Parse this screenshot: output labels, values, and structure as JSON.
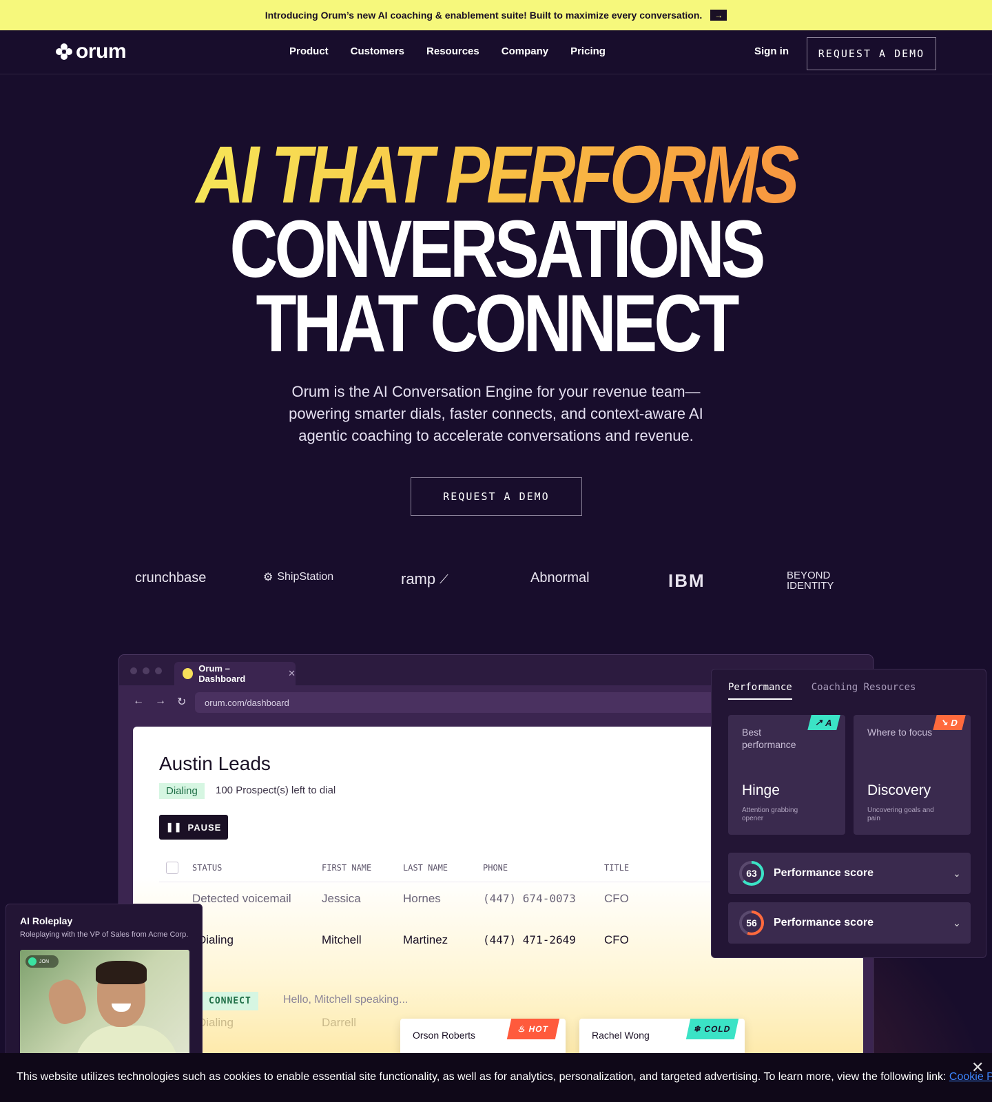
{
  "announcement": {
    "text": "Introducing Orum’s new AI coaching & enablement suite! Built to maximize every conversation.",
    "arrow_icon": "arrow-right-icon"
  },
  "nav": {
    "logo_text": "orum",
    "links": [
      "Product",
      "Customers",
      "Resources",
      "Company",
      "Pricing"
    ],
    "signin": "Sign in",
    "cta": "REQUEST A DEMO"
  },
  "hero": {
    "line1": "AI THAT PERFORMS",
    "line2": "CONVERSATIONS",
    "line3": "THAT CONNECT",
    "subtitle": "Orum is the AI Conversation Engine for your revenue team—powering smarter dials, faster connects, and context-aware AI agentic coaching to accelerate conversations and revenue.",
    "cta": "REQUEST A DEMO"
  },
  "customers": [
    "crunchbase",
    "ShipStation",
    "ramp",
    "Abnormal",
    "IBM",
    "BEYOND IDENTITY"
  ],
  "dashboard": {
    "tab_title": "Orum – Dashboard",
    "url": "orum.com/dashboard",
    "title": "Austin Leads",
    "status_badge": "Dialing",
    "prospects": "100 Prospect(s) left to dial",
    "pause_label": "PAUSE",
    "columns": [
      "STATUS",
      "FIRST NAME",
      "LAST NAME",
      "PHONE",
      "TITLE"
    ],
    "rows": [
      {
        "status": "Detected voicemail",
        "first": "Jessica",
        "last": "Hornes",
        "phone": "(447) 674-0073",
        "title": "CFO"
      },
      {
        "status": "Dialing",
        "first": "Mitchell",
        "last": "Martinez",
        "phone": "(447) 471-2649",
        "title": "CFO"
      },
      {
        "status": "Dialing",
        "first": "Darrell",
        "last": "",
        "phone": "",
        "title": ""
      }
    ],
    "connect_badge": "CONNECT",
    "connect_text": "Hello, Mitchell speaking...",
    "lead_cards": [
      {
        "name": "Orson Roberts",
        "tag": "HOT",
        "color": "#ff5a3c"
      },
      {
        "name": "Rachel Wong",
        "tag": "COLD",
        "color": "#3be3c6"
      }
    ]
  },
  "performance": {
    "tabs": [
      "Performance",
      "Coaching Resources"
    ],
    "cards": [
      {
        "label": "Best performance",
        "value": "Hinge",
        "detail": "Attention grabbing opener",
        "grade": "A",
        "color": "#3be3c6"
      },
      {
        "label": "Where to focus",
        "value": "Discovery",
        "detail": "Uncovering goals and pain",
        "grade": "D",
        "color": "#ff6a3d"
      }
    ],
    "scores": [
      {
        "score": "63",
        "label": "Performance score",
        "color": "#3be3c6"
      },
      {
        "score": "56",
        "label": "Performance score",
        "color": "#ff6a3d"
      }
    ]
  },
  "roleplay": {
    "title": "AI Roleplay",
    "subtitle": "Roleplaying with the VP of Sales from Acme Corp.",
    "speaker_tag": "JON"
  },
  "cookie": {
    "text": "This website utilizes technologies such as cookies to enable essential site functionality, as well as for analytics, personalization, and targeted advertising. To learn more, view the following link: ",
    "link": "Cookie Policy"
  },
  "colors": {
    "background": "#180d2c",
    "banner": "#f6f87c",
    "gradient_start": "#f6f35f",
    "gradient_end": "#f7863d"
  }
}
